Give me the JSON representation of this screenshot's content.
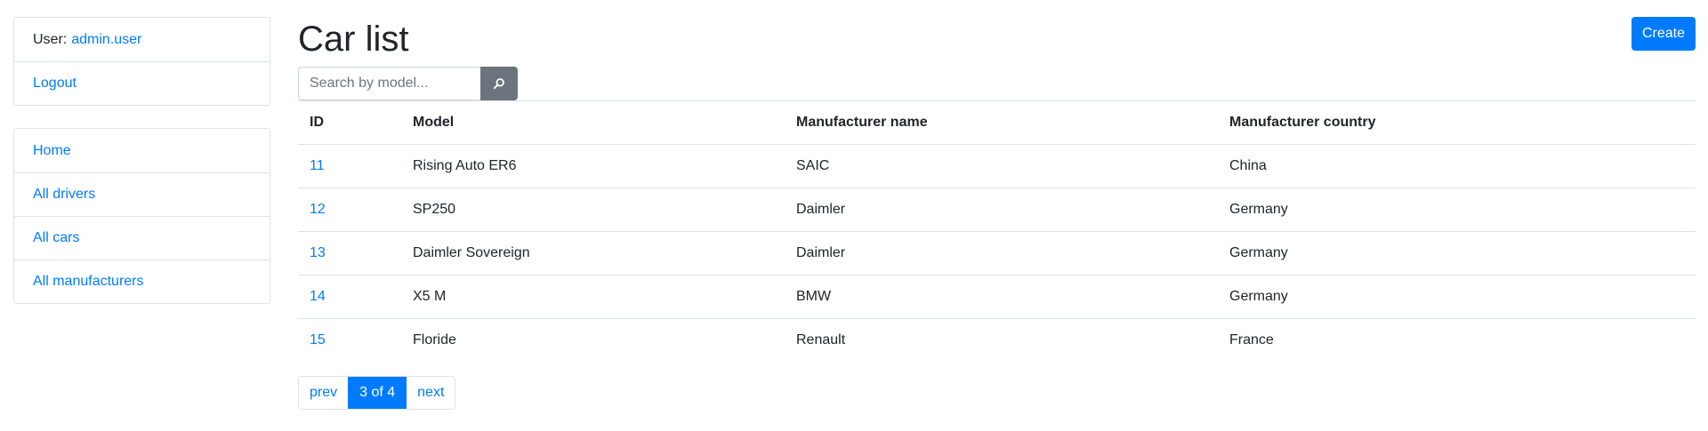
{
  "sidebar": {
    "user_label": "User:",
    "username": "admin.user",
    "logout": "Logout",
    "nav": [
      {
        "label": "Home"
      },
      {
        "label": "All drivers"
      },
      {
        "label": "All cars"
      },
      {
        "label": "All manufacturers"
      }
    ]
  },
  "header": {
    "title": "Car list",
    "create_label": "Create"
  },
  "search": {
    "placeholder": "Search by model...",
    "value": "",
    "icon": "search-icon"
  },
  "table": {
    "columns": [
      "ID",
      "Model",
      "Manufacturer name",
      "Manufacturer country"
    ],
    "rows": [
      {
        "id": "11",
        "model": "Rising Auto ER6",
        "manufacturer": "SAIC",
        "country": "China"
      },
      {
        "id": "12",
        "model": "SP250",
        "manufacturer": "Daimler",
        "country": "Germany"
      },
      {
        "id": "13",
        "model": "Daimler Sovereign",
        "manufacturer": "Daimler",
        "country": "Germany"
      },
      {
        "id": "14",
        "model": "X5 M",
        "manufacturer": "BMW",
        "country": "Germany"
      },
      {
        "id": "15",
        "model": "Floride",
        "manufacturer": "Renault",
        "country": "France"
      }
    ]
  },
  "pagination": {
    "prev": "prev",
    "current": "3 of 4",
    "next": "next"
  },
  "colors": {
    "primary": "#007bff",
    "secondary": "#6c757d",
    "border": "#dee2e6"
  }
}
